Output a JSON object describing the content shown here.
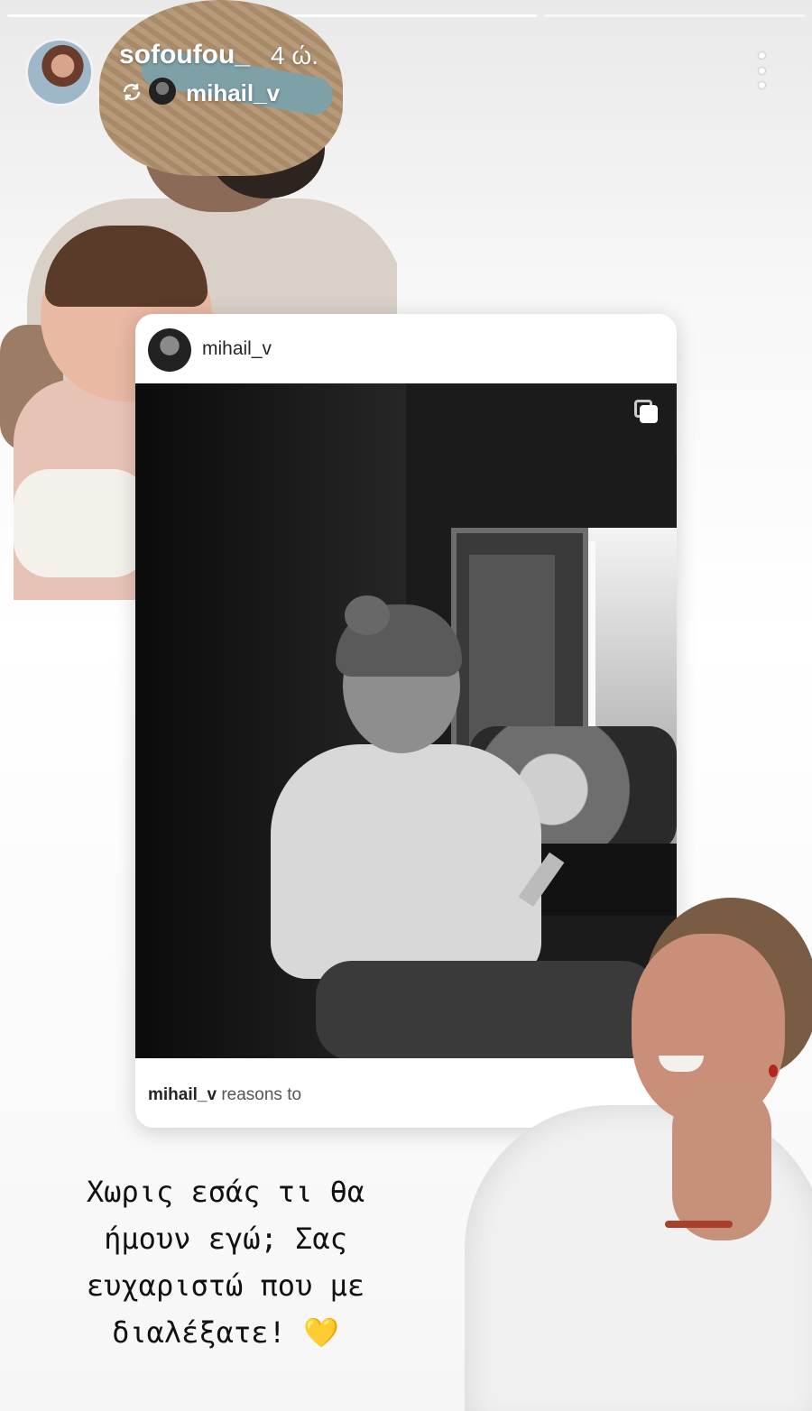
{
  "story": {
    "progress_segments": 3,
    "progress_done": 2
  },
  "header": {
    "username": "sofoufou_",
    "time": "4 ώ.",
    "repost_user": "mihail_v",
    "repost_icon": "repost-icon",
    "more_icon": "more-options-icon"
  },
  "post": {
    "username": "mihail_v",
    "caption_user": "mihail_v",
    "caption_text": "reasons to",
    "multi_icon": "carousel-icon"
  },
  "message": {
    "line1": "Χωρις εσάς τι θα",
    "line2": "ήμουν εγώ; Σας",
    "line3": "ευχαριστώ που με",
    "line4": "διαλέξατε!",
    "emoji": "💛"
  }
}
